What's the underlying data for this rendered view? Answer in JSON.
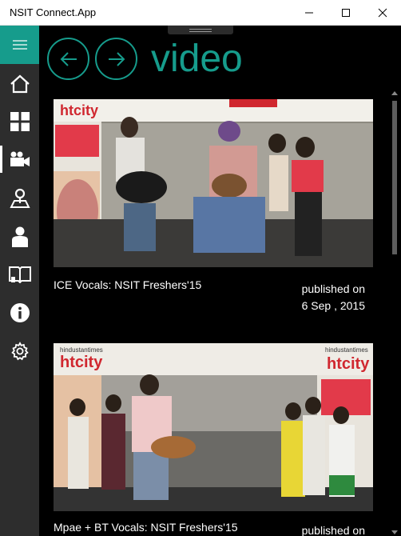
{
  "window": {
    "title": "NSIT Connect.App",
    "controls": [
      "minimize-icon",
      "maximize-icon",
      "close-icon"
    ]
  },
  "sidebar": {
    "menu_icon": "hamburger-icon",
    "items": [
      {
        "id": "home",
        "icon": "home-icon",
        "active": false
      },
      {
        "id": "dashboard",
        "icon": "grid-icon",
        "active": false
      },
      {
        "id": "video",
        "icon": "video-camera-icon",
        "active": true
      },
      {
        "id": "map",
        "icon": "location-pin-icon",
        "active": false
      },
      {
        "id": "profile",
        "icon": "person-icon",
        "active": false
      },
      {
        "id": "library",
        "icon": "book-icon",
        "active": false
      },
      {
        "id": "about",
        "icon": "info-icon",
        "active": false
      },
      {
        "id": "settings",
        "icon": "gear-icon",
        "active": false
      }
    ]
  },
  "header": {
    "back_icon": "arrow-left-icon",
    "forward_icon": "arrow-right-icon",
    "title": "video"
  },
  "colors": {
    "accent": "#169c8c",
    "sidebar_bg": "#2d2d2d",
    "background": "#000000",
    "text": "#ffffff"
  },
  "videos": [
    {
      "title": "ICE Vocals: NSIT Freshers'15",
      "published_label": "published on",
      "published_date": "6 Sep , 2015",
      "thumbnail_banner": "htcity"
    },
    {
      "title": "Mpae + BT Vocals: NSIT Freshers'15",
      "published_label": "published on",
      "published_date": "",
      "thumbnail_banner": "htcity",
      "thumbnail_banner_top": "hindustantimes"
    }
  ]
}
